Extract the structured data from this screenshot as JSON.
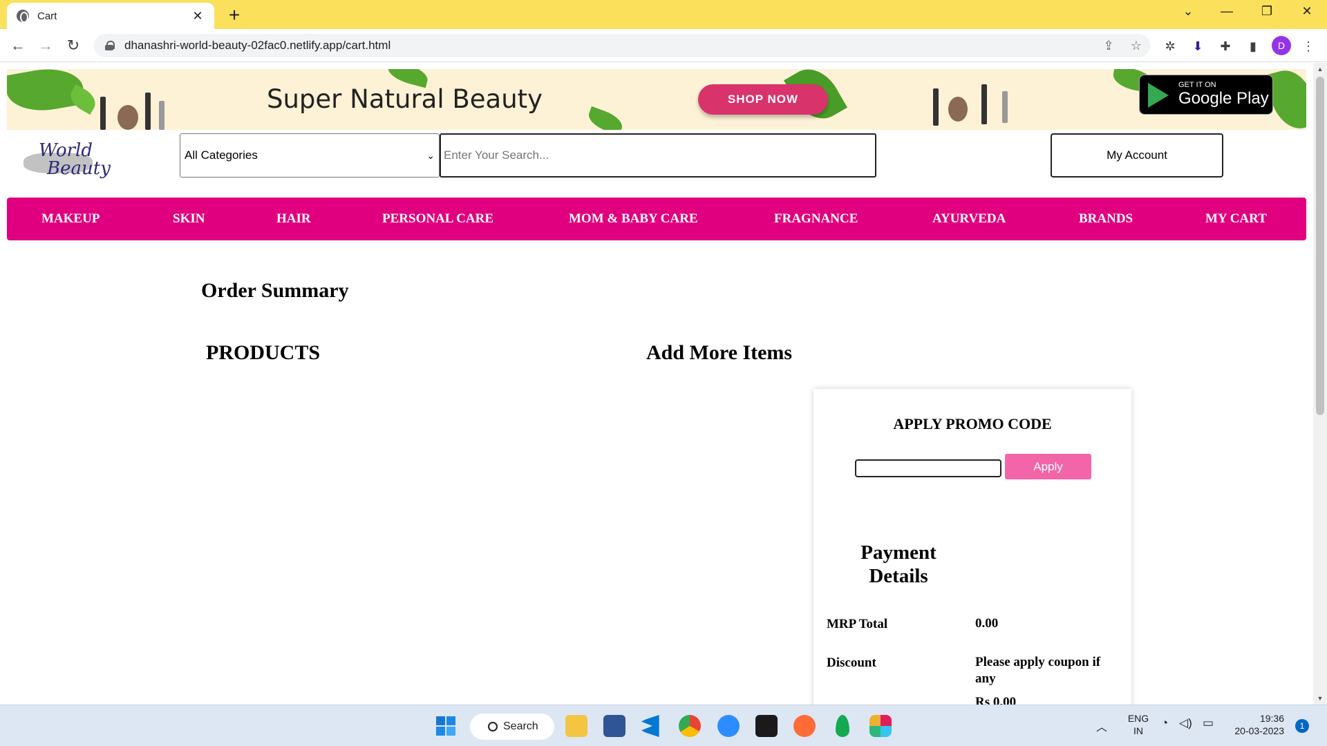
{
  "browser": {
    "tab_title": "Cart",
    "tab_close": "✕",
    "new_tab": "+",
    "url": "dhanashri-world-beauty-02fac0.netlify.app/cart.html",
    "profile_initial": "D",
    "window_controls": [
      "⌄",
      "—",
      "❐",
      "✕"
    ]
  },
  "banner": {
    "title": "Super Natural Beauty",
    "shop_button": "SHOP NOW",
    "store_small": "GET IT ON",
    "store_big": "Google Play"
  },
  "header": {
    "logo_line1": "World",
    "logo_line2": "Beauty",
    "category_selected": "All Categories",
    "search_placeholder": "Enter Your Search...",
    "account_label": "My Account"
  },
  "nav": {
    "items": [
      "MAKEUP",
      "SKIN",
      "HAIR",
      "PERSONAL CARE",
      "MOM & BABY CARE",
      "FRAGNANCE",
      "AYURVEDA",
      "BRANDS",
      "MY CART"
    ]
  },
  "cart": {
    "order_summary": "Order Summary",
    "products_heading": "PRODUCTS",
    "add_more": "Add More Items",
    "promo_title": "APPLY PROMO CODE",
    "promo_value": "",
    "apply_button": "Apply",
    "payment_title": "Payment Details",
    "rows": [
      {
        "label": "MRP Total",
        "value": "0.00"
      },
      {
        "label": "Discount",
        "value": "Please apply coupon if any"
      },
      {
        "label": "",
        "value": "Rs 0.00"
      }
    ]
  },
  "taskbar": {
    "search_label": "Search",
    "lang_top": "ENG",
    "lang_bottom": "IN",
    "time": "19:36",
    "date": "20-03-2023",
    "notification_count": "1"
  },
  "colors": {
    "nav_pink": "#e0007f",
    "apply_pink": "#f265a9",
    "shop_button": "#d9336b",
    "tab_strip": "#fbe05c"
  }
}
